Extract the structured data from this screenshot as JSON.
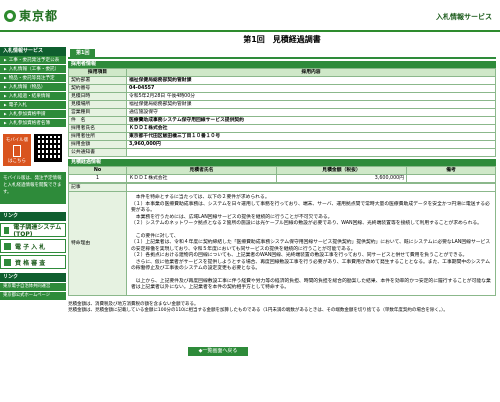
{
  "header": {
    "logo_text": "東京都",
    "site_title": "入札情報サービス"
  },
  "sidebar": {
    "section1_title": "入札情報サービス",
    "items": [
      {
        "label": "工事・委託発注予定公表"
      },
      {
        "label": "入札情報（工事・委託）"
      },
      {
        "label": "物品・委託等発注予定"
      },
      {
        "label": "入札情報（物品）"
      },
      {
        "label": "入札経過・結果情報"
      },
      {
        "label": "電子入札"
      },
      {
        "label": "入札参加資格申請"
      },
      {
        "label": "入札参加資格者名簿"
      }
    ],
    "mobile_label": "モバイル版",
    "mobile_sub": "はこちら",
    "mobile_note": "モバイル版は、発注予定情報と入札経過情報を閲覧できます。",
    "section2_title": "リンク",
    "links_big": [
      {
        "label": "電子調達システム(TOP)"
      },
      {
        "label": "電 子 入 札"
      },
      {
        "label": "資 格 審 査"
      }
    ],
    "section3_title": "リンク",
    "links_small": [
      {
        "label": "東京電子自治体共同運営"
      },
      {
        "label": "東京都公式ホームページ"
      }
    ]
  },
  "main": {
    "title": "第1回　見積経過調書",
    "tab_label": "第1回",
    "section_purchase": "採用者情報",
    "table_headers": [
      "採用項目",
      "採用内容"
    ],
    "rows": [
      {
        "label": "契約部署",
        "value": "福祉保健局総務部契約管財課"
      },
      {
        "label": "契約番号",
        "value": "04-04557"
      },
      {
        "label": "見積日時",
        "value": "令和5年2月28日 午後4時00分"
      },
      {
        "label": "見積場所",
        "value": "福祉保健局総務部契約管財課"
      },
      {
        "label": "営業種目",
        "value": "通信施設保守"
      },
      {
        "label": "件　名",
        "value": "医療費助成事務システム保守用回線サービス提供契約"
      },
      {
        "label": "採用者氏名",
        "value": "ＫＤＤＩ株式会社"
      },
      {
        "label": "採用者住所",
        "value": "東京都千代田区飯田橋三丁目１０番１０号"
      },
      {
        "label": "採用金額",
        "value": "3,960,000円"
      },
      {
        "label": "公共通知書",
        "value": ""
      }
    ],
    "section_mitsumori": "見積経過情報",
    "mitsu_headers": [
      "No",
      "見積者氏名",
      "見積金額（税抜）",
      "備考"
    ],
    "mitsu_rows": [
      {
        "no": "1",
        "name": "ＫＤＤＩ株式会社",
        "amount": "3,600,000円",
        "note": ""
      }
    ],
    "kiji_label": "記事",
    "tokki_label": "特命理由",
    "tokki_lines": [
      "　本件を特命とするに当たっては、以下の２要件が求められる。",
      "（１）本事業の医療費助成事務は、システムを日々運用して事務を行っており、端末、サーバ、運用拠点間で常時大量の医療費助成データを安全かつ円滑に電送する必要がある。",
      "　本業務を行うためには、広域LAN回線サービスの提供を継続的に行うことが不可欠である。",
      "（２）システムのネットワーク拠点となる２箇所の施設には光ケーブル回線の敷設が必要であり、WAN回線、光終端装置等を接続して利用することが求められる。",
      "",
      "　この要件に対して、",
      "（１）上記業者は、令和４年度に契約締結した「医療費助成事務システム保守用回線サービス提供契約」提供契約」において、既にシステムに必要なLAN回線サービスの安定稼働を実現しており、令和５年度においても同サービスの提供を継続的に行うことが可能である。",
      "（２）各拠点における建物内の回線についても、上記業者のWAN回線、光終端装置の敷設工事を行っており、同サービスと併せて費用を負うことができる。",
      "　さらに、仮に他業者がサービスを提供しようとする場合、再度回線敷設工事を行う必要があり、工事費用が改めて発生することとなる。また、工事期間中のシステムの稼働停止及び工事後のシステムの設定変更も必要となる。",
      "",
      "　以上から、上記要件及び再度回線敷設工事に伴う経費や労力等の経済的負担、時間的負担を総合的勘案した結果、本件を効率的かつ安定的に履行することが可能な業者は上記業者以外にない。上記業者を本件の契約相手方として特命する。"
    ],
    "footnotes": [
      "見積金額は、消費税及び地方消費税の額を含まない金額である。",
      "見積金額は、見積金額に記載している金額に100分の110に相当する金額を加算したものである（1円未満の端数があるときは、その端数金額を切り捨てる（単数年度契約の場合を除く。）。"
    ],
    "back_button": "◆一覧画面へ戻る"
  },
  "colors": {
    "brand_green": "#2e8b3a",
    "dark_green": "#0f5f2f",
    "label_bg": "#e6f2e1"
  }
}
